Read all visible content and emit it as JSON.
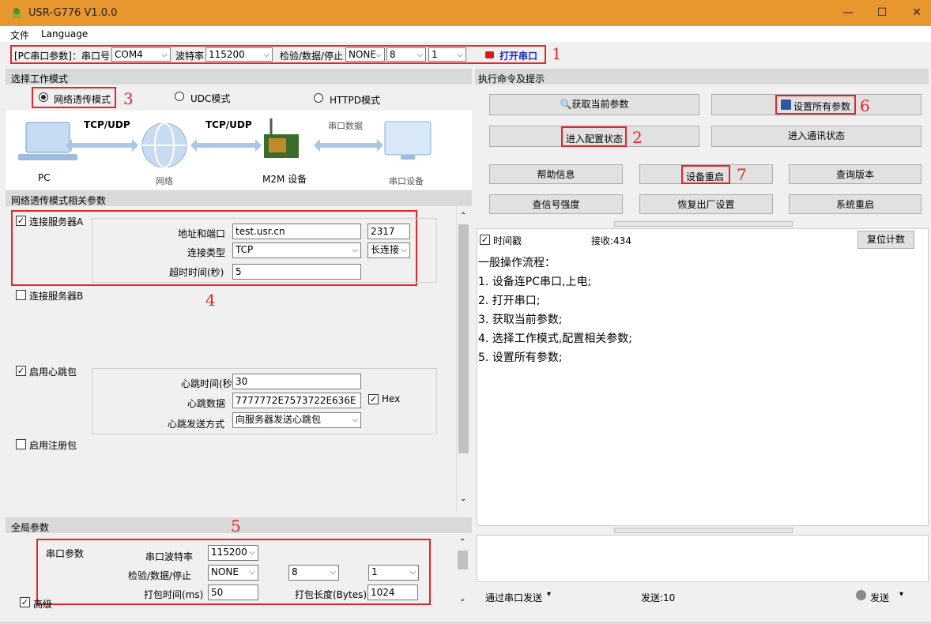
{
  "window": {
    "title": "USR-G776 V1.0.0",
    "minimize": "—",
    "maximize": "☐",
    "close": "✕"
  },
  "menu": {
    "file": "文件",
    "language": "Language"
  },
  "serial": {
    "param_label": "[PC串口参数]：串口号",
    "port": "COM4",
    "baud_label": "波特率",
    "baud": "115200",
    "check_label": "检验/数据/停止",
    "parity": "NONE",
    "databits": "8",
    "stopbits": "1",
    "open_label": "打开串口",
    "mark": "1"
  },
  "mode": {
    "header": "选择工作模式",
    "options": [
      {
        "label": "网络透传模式",
        "selected": true
      },
      {
        "label": "UDC模式",
        "selected": false
      },
      {
        "label": "HTTPD模式",
        "selected": false
      }
    ],
    "mark": "3"
  },
  "diagram": {
    "pc": "PC",
    "tcp1": "TCP/UDP",
    "net": "网络",
    "tcp2": "TCP/UDP",
    "m2m": "M2M 设备",
    "serial_data": "串口数据",
    "serial_dev": "串口设备"
  },
  "net_params": {
    "header": "网络透传模式相关参数",
    "serverA": {
      "label": "连接服务器A",
      "checked": true,
      "addr_label": "地址和端口",
      "addr": "test.usr.cn",
      "port": "2317",
      "type_label": "连接类型",
      "type": "TCP",
      "conn": "长连接",
      "timeout_label": "超时时间(秒)",
      "timeout": "5"
    },
    "mark": "4",
    "serverB": {
      "label": "连接服务器B",
      "checked": false
    },
    "heartbeat": {
      "label": "启用心跳包",
      "checked": true,
      "time_label": "心跳时间(秒)",
      "time": "30",
      "data_label": "心跳数据",
      "data": "7777772E7573722E636E",
      "hex": "Hex",
      "mode_label": "心跳发送方式",
      "mode": "向服务器发送心跳包"
    },
    "register": {
      "label": "启用注册包",
      "checked": false
    }
  },
  "global": {
    "header": "全局参数",
    "mark": "5",
    "serial_label": "串口参数",
    "baud_label": "串口波特率",
    "baud": "115200",
    "check_label": "检验/数据/停止",
    "parity": "NONE",
    "databits": "8",
    "stopbits": "1",
    "pack_time_label": "打包时间(ms)",
    "pack_time": "50",
    "pack_len_label": "打包长度(Bytes)",
    "pack_len": "1024",
    "advanced": "高级"
  },
  "cmd": {
    "header": "执行命令及提示",
    "get_params": "获取当前参数",
    "set_all": "设置所有参数",
    "mark6": "6",
    "enter_config": "进入配置状态",
    "mark2": "2",
    "enter_comm": "进入通讯状态",
    "help": "帮助信息",
    "restart": "设备重启",
    "mark7": "7",
    "query_ver": "查询版本",
    "signal": "查信号强度",
    "factory": "恢复出厂设置",
    "sys_restart": "系统重启"
  },
  "log": {
    "timestamp_label": "时间戳",
    "recv": "接收:434",
    "reset": "复位计数",
    "lines": [
      "一般操作流程：",
      "1. 设备连PC串口,上电;",
      "2. 打开串口;",
      "3. 获取当前参数;",
      "4. 选择工作模式,配置相关参数;",
      "5. 设置所有参数;"
    ]
  },
  "send": {
    "via": "通过串口发送",
    "sent": "发送:10",
    "send_btn": "发送"
  }
}
